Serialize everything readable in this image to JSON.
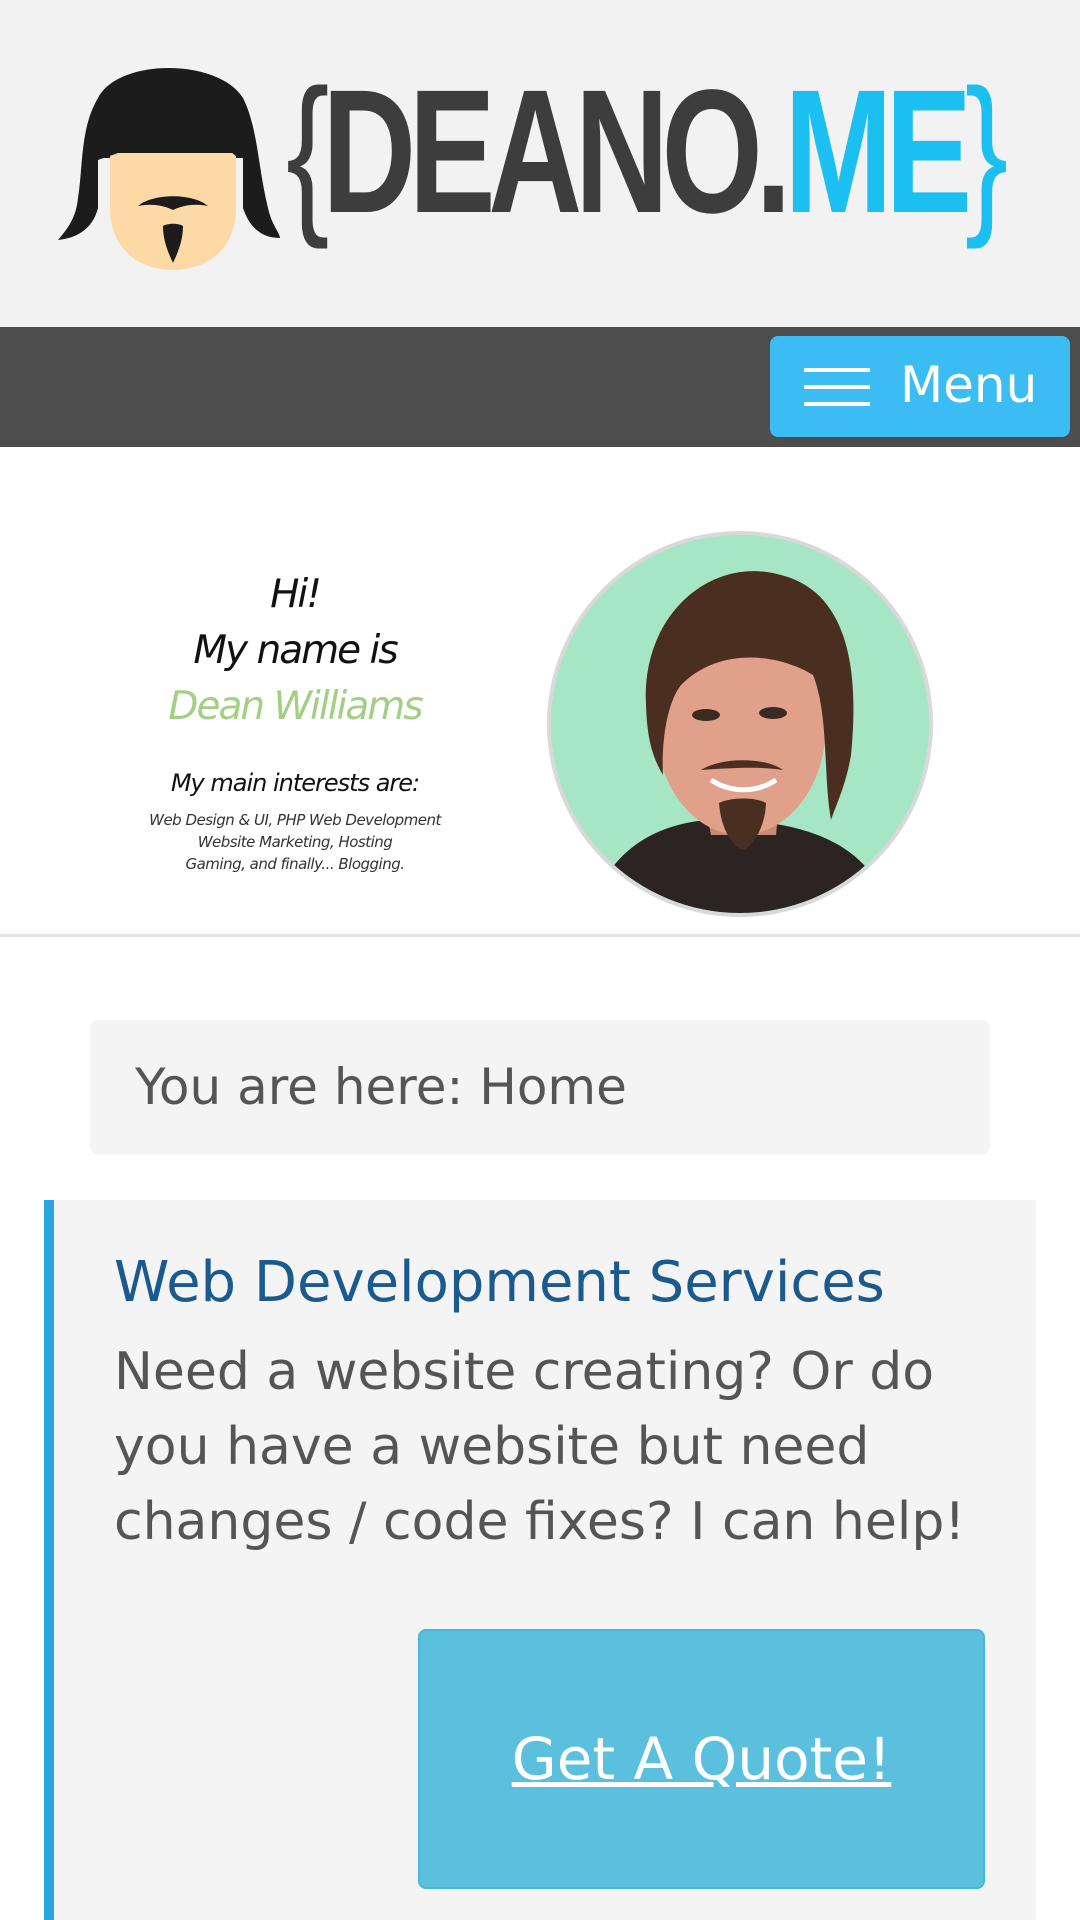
{
  "header": {
    "logo": {
      "text_open": "{",
      "text_main": "DEANO.",
      "text_accent": "ME",
      "text_close": "}",
      "mascot_icon": "bearded-face-icon"
    }
  },
  "nav": {
    "menu_label": "Menu",
    "menu_icon": "hamburger-icon"
  },
  "banner": {
    "greeting": "Hi!",
    "name_intro": "My name is",
    "name": "Dean Williams",
    "interests_heading": "My main interests are:",
    "interests_lines": [
      "Web Design & UI, PHP Web Development",
      "Website Marketing, Hosting",
      "Gaming, and finally... Blogging."
    ],
    "photo": "profile-photo"
  },
  "breadcrumb": {
    "text": "You are here: Home"
  },
  "service": {
    "title": "Web Development Services",
    "description": "Need a website creating? Or do you have a website but need changes / code fixes? I can help!",
    "button_label": "Get A Quote!"
  },
  "colors": {
    "accent_blue": "#1cc0f0",
    "menu_button": "#3bbdf3",
    "navbar": "#4d4d4d",
    "name_green": "#a3cf83",
    "title_blue": "#1a5a8e",
    "quote_button": "#5bc0de"
  }
}
